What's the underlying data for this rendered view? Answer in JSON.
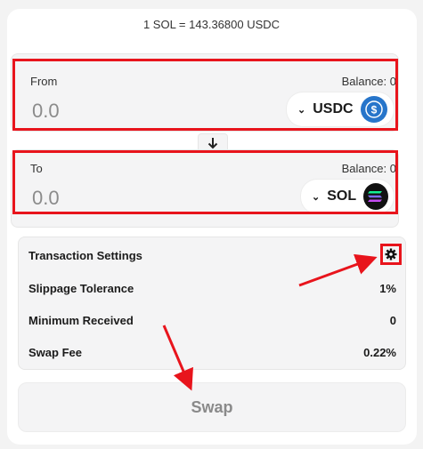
{
  "rate": "1 SOL = 143.36800 USDC",
  "from": {
    "label": "From",
    "balance": "Balance: 0",
    "amount_placeholder": "0.0",
    "token": "USDC"
  },
  "to": {
    "label": "To",
    "balance": "Balance: 0",
    "amount_placeholder": "0.0",
    "token": "SOL"
  },
  "settings": {
    "title": "Transaction Settings",
    "rows": [
      {
        "label": "Slippage Tolerance",
        "value": "1%"
      },
      {
        "label": "Minimum Received",
        "value": "0"
      },
      {
        "label": "Swap Fee",
        "value": "0.22%"
      }
    ]
  },
  "swap_label": "Swap",
  "colors": {
    "annotation": "#e8141c",
    "usdc": "#2775ca",
    "sol": "#111111"
  },
  "icons": {
    "switch": "arrow-down-icon",
    "settings": "gear-icon",
    "chevron": "chevron-down-icon"
  }
}
